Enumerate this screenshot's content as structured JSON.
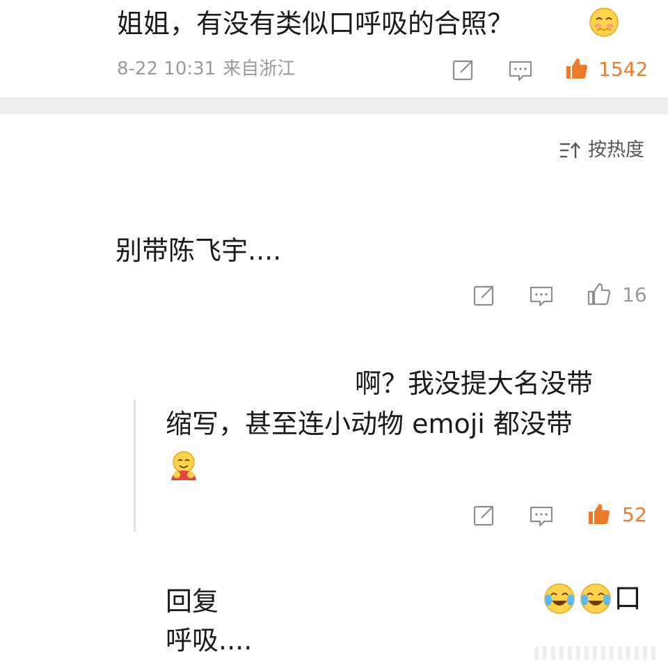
{
  "post": {
    "text": "姐姐，有没有类似口呼吸的合照？",
    "emoji": "shy-face-emoji",
    "date": "8-22 10:31",
    "source": "来自浙江",
    "likes": "1542"
  },
  "sort": {
    "label": "按热度"
  },
  "comment1": {
    "text": "别带陈飞宇....",
    "likes": "16"
  },
  "reply": {
    "line1": "啊？我没提大名没带",
    "line2": "缩写，甚至连小动物 emoji 都没带",
    "emoji": "hug-face-emoji",
    "likes": "52"
  },
  "subreply": {
    "line1": "回复",
    "line2": "呼吸....",
    "trailing_char": "口",
    "emojis": [
      "laugh-cry-emoji",
      "laugh-cry-emoji"
    ]
  },
  "colors": {
    "like_active": "#ef7a2a",
    "muted_text": "#9a9a9a",
    "divider": "#eeeeee"
  }
}
